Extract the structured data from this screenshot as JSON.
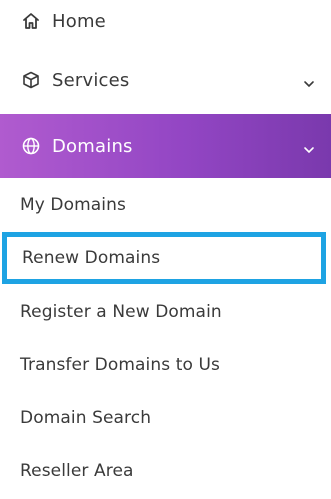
{
  "menu": {
    "home": {
      "label": "Home",
      "icon": "home-icon"
    },
    "services": {
      "label": "Services",
      "icon": "box-icon"
    },
    "domains": {
      "label": "Domains",
      "icon": "globe-icon",
      "active_gradient": [
        "#b05bcf",
        "#7a39ad"
      ],
      "subitems": [
        {
          "label": "My Domains"
        },
        {
          "label": "Renew Domains",
          "selected": true
        },
        {
          "label": "Register a New Domain"
        },
        {
          "label": "Transfer Domains to Us"
        },
        {
          "label": "Domain Search"
        },
        {
          "label": "Reseller Area"
        }
      ]
    }
  },
  "colors": {
    "text": "#3a3a3a",
    "highlight_border": "#1ea3e3"
  }
}
